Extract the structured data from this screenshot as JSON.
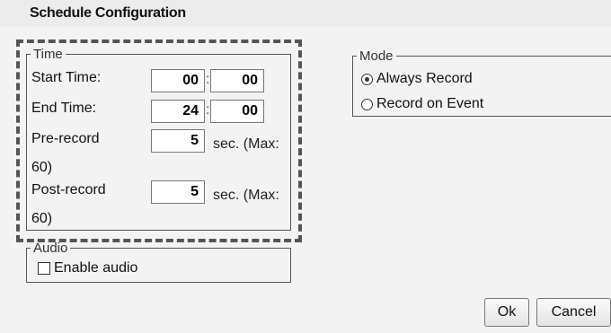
{
  "dialog": {
    "title": "Schedule Configuration"
  },
  "time": {
    "legend": "Time",
    "start": {
      "label": "Start Time:",
      "hours": "00",
      "minutes": "00",
      "separator": ":"
    },
    "end": {
      "label": "End Time:",
      "hours": "24",
      "minutes": "00",
      "separator": ":"
    },
    "pre_record": {
      "label": "Pre-record",
      "value": "5",
      "unit_line1": "sec. (Max:",
      "unit_line2": "60)"
    },
    "post_record": {
      "label": "Post-record",
      "value": "5",
      "unit_line1": "sec. (Max:",
      "unit_line2": "60)"
    }
  },
  "audio": {
    "legend": "Audio",
    "enable_label": "Enable audio",
    "enabled": false
  },
  "mode": {
    "legend": "Mode",
    "options": [
      {
        "label": "Always Record",
        "selected": true
      },
      {
        "label": "Record on Event",
        "selected": false
      }
    ]
  },
  "buttons": {
    "ok": "Ok",
    "cancel": "Cancel"
  }
}
